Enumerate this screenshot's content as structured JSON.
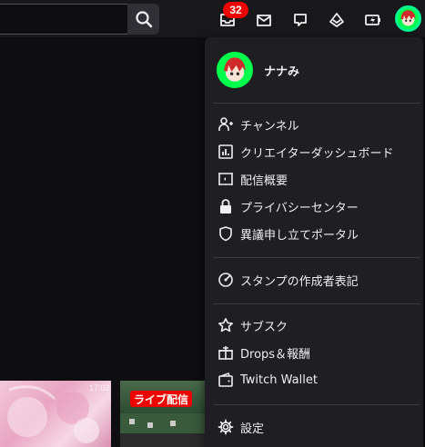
{
  "search": {
    "value": "",
    "placeholder": ""
  },
  "notifications": {
    "count": "32"
  },
  "top_nav_icons": [
    "inbox-icon",
    "mail-icon",
    "whispers-icon",
    "prime-gaming-icon",
    "bits-icon"
  ],
  "user": {
    "name": "ナナみ"
  },
  "menu": {
    "group1": [
      {
        "icon": "person-icon",
        "label": "チャンネル"
      },
      {
        "icon": "dashboard-icon",
        "label": "クリエイターダッシュボード"
      },
      {
        "icon": "stream-summary-icon",
        "label": "配信概要"
      },
      {
        "icon": "lock-icon",
        "label": "プライバシーセンター"
      },
      {
        "icon": "shield-icon",
        "label": "異議申し立てポータル"
      }
    ],
    "group2": [
      {
        "icon": "sticker-icon",
        "label": "スタンプの作成者表記"
      }
    ],
    "group3": [
      {
        "icon": "star-icon",
        "label": "サブスク"
      },
      {
        "icon": "gift-icon",
        "label": "Drops＆報酬"
      },
      {
        "icon": "wallet-icon",
        "label": "Twitch Wallet"
      }
    ],
    "group4": [
      {
        "icon": "gear-icon",
        "label": "設定"
      }
    ]
  },
  "thumbnails": [
    {
      "time": "17:02"
    },
    {
      "live_label": "ライブ配信"
    }
  ],
  "colors": {
    "accent_green": "#00ff4c",
    "badge_red": "#eb0400",
    "menu_bg": "#1f1f23"
  }
}
